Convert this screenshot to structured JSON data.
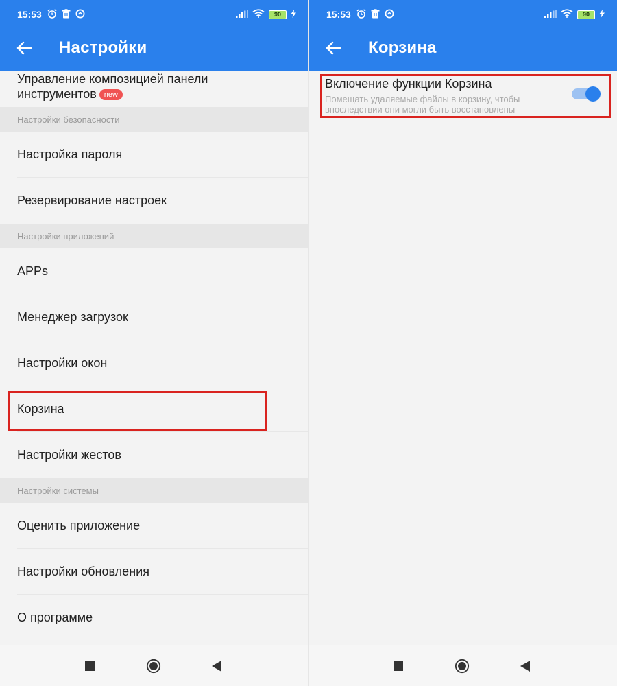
{
  "left": {
    "status": {
      "time": "15:53",
      "battery": "90"
    },
    "title": "Настройки",
    "first_item": {
      "label": "Управление композицией панели инструментов",
      "line1": "Управление композицией панели",
      "line2": "инструментов",
      "badge": "new"
    },
    "sections": {
      "security": "Настройки безопасности",
      "apps": "Настройки приложений",
      "system": "Настройки системы"
    },
    "items": {
      "password": "Настройка пароля",
      "backup": "Резервирование настроек",
      "apps": "APPs",
      "downloads": "Менеджер загрузок",
      "windows": "Настройки окон",
      "trash": "Корзина",
      "gestures": "Настройки жестов",
      "rate": "Оценить приложение",
      "updates": "Настройки обновления",
      "about": "О программе"
    }
  },
  "right": {
    "status": {
      "time": "15:53",
      "battery": "90"
    },
    "title": "Корзина",
    "setting": {
      "title": "Включение функции Корзина",
      "desc_line1": "Помещать удаляемые файлы в корзину, чтобы",
      "desc_line2": "впоследствии они могли быть восстановлены",
      "enabled": true
    }
  },
  "colors": {
    "accent": "#2a80ec",
    "highlight": "#d9231f",
    "badge": "#f05353"
  },
  "icons": [
    "alarm-icon",
    "trash-status-icon",
    "sync-status-icon",
    "signal-icon",
    "wifi-icon",
    "battery-icon",
    "charging-icon",
    "back-arrow-icon",
    "nav-square-icon",
    "nav-home-icon",
    "nav-back-icon"
  ]
}
